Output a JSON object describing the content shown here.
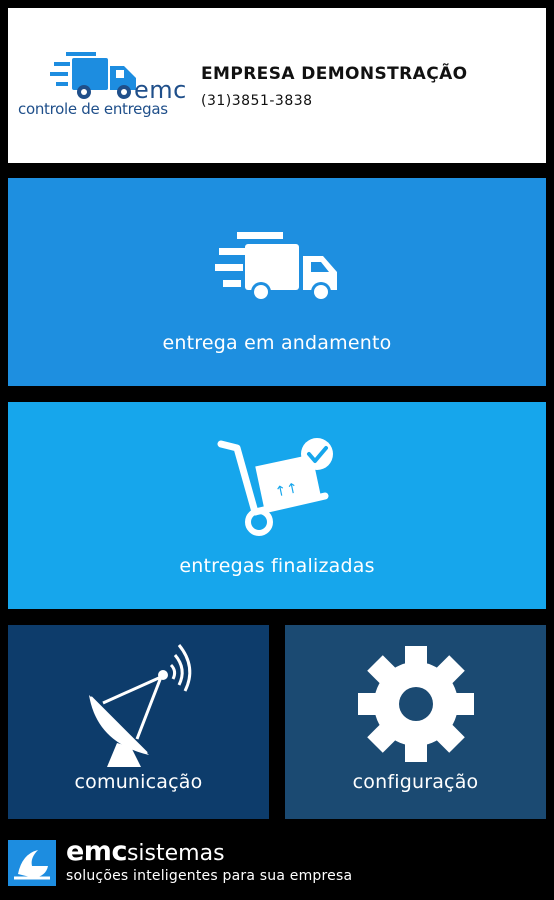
{
  "header": {
    "logo_brand": "emc",
    "logo_subtitle": "controle de entregas",
    "company_name": "EMPRESA DEMONSTRAÇÃO",
    "company_phone": "(31)3851-3838"
  },
  "tiles": {
    "andamento": {
      "label": "entrega em andamento",
      "icon": "delivery-truck-icon"
    },
    "finalizadas": {
      "label": "entregas finalizadas",
      "icon": "hand-truck-check-icon"
    },
    "comunicacao": {
      "label": "comunicação",
      "icon": "satellite-dish-icon"
    },
    "configuracao": {
      "label": "configuração",
      "icon": "gear-icon"
    }
  },
  "footer": {
    "brand_part1": "emc",
    "brand_part2": "sistemas",
    "tagline": "soluções inteligentes para sua empresa"
  },
  "colors": {
    "tile_andamento": "#1e8fe0",
    "tile_finalizadas": "#16a6ec",
    "tile_comunicacao": "#0d3c6b",
    "tile_configuracao": "#1b4a72",
    "brand_blue": "#1f4f8a"
  }
}
